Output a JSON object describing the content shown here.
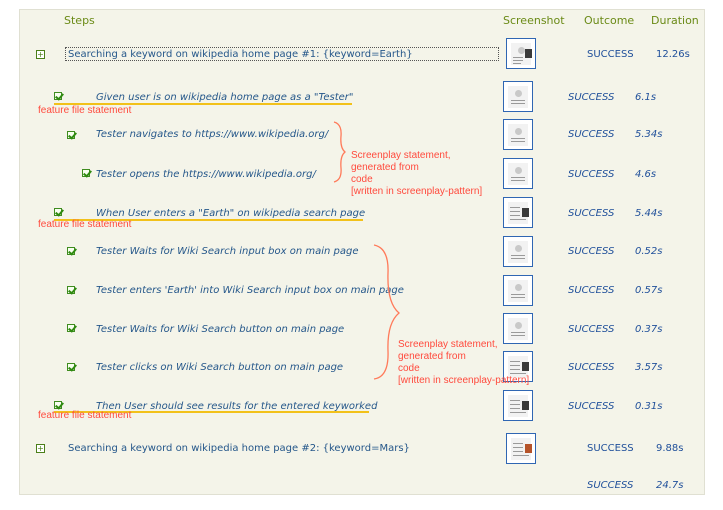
{
  "headers": {
    "steps": "Steps",
    "screenshot": "Screenshot",
    "outcome": "Outcome",
    "duration": "Duration"
  },
  "scenarios": [
    {
      "title": "Searching a keyword on wikipedia home page #1: {keyword=Earth}",
      "outcome": "SUCCESS",
      "duration": "12.26s"
    },
    {
      "title": "Searching a keyword on wikipedia home page #2: {keyword=Mars}",
      "outcome": "SUCCESS",
      "duration": "9.88s"
    }
  ],
  "steps": [
    {
      "text": "Given user is on wikipedia home page as a \"Tester\"",
      "outcome": "SUCCESS",
      "duration": "6.1s"
    },
    {
      "text": "Tester navigates to https://www.wikipedia.org/",
      "outcome": "SUCCESS",
      "duration": "5.34s"
    },
    {
      "text": "Tester opens the https://www.wikipedia.org/",
      "outcome": "SUCCESS",
      "duration": "4.6s"
    },
    {
      "text": "When User enters a \"Earth\" on wikipedia search page",
      "outcome": "SUCCESS",
      "duration": "5.44s"
    },
    {
      "text": "Tester Waits for Wiki Search input box on main page",
      "outcome": "SUCCESS",
      "duration": "0.52s"
    },
    {
      "text": "Tester enters 'Earth' into Wiki Search input box on main page",
      "outcome": "SUCCESS",
      "duration": "0.57s"
    },
    {
      "text": "Tester Waits for Wiki Search button on main page",
      "outcome": "SUCCESS",
      "duration": "0.37s"
    },
    {
      "text": "Tester clicks on Wiki Search button on main page",
      "outcome": "SUCCESS",
      "duration": "3.57s"
    },
    {
      "text": "Then User should see results for the entered keyworked",
      "outcome": "SUCCESS",
      "duration": "0.31s"
    }
  ],
  "total": {
    "outcome": "SUCCESS",
    "duration": "24.7s"
  },
  "annotations": {
    "feature1": "feature file statement",
    "feature2": "feature file statement",
    "feature3": "feature file statement",
    "screenplay1": [
      "Screenplay statement,",
      "generated from",
      "code",
      "[written in screenplay-pattern]"
    ],
    "screenplay2": [
      "Screenplay statement,",
      "generated from",
      "code",
      "[written in screenplay-pattern]"
    ]
  },
  "icons": {
    "expand": "plus-box-icon",
    "check": "check-box-icon"
  },
  "colors": {
    "header": "#6a8a16",
    "link": "#25578a",
    "success": "#1f4f9a",
    "annotation": "#ff4a3d",
    "underline": "#f2c11a",
    "panel": "#f4f4e9"
  }
}
